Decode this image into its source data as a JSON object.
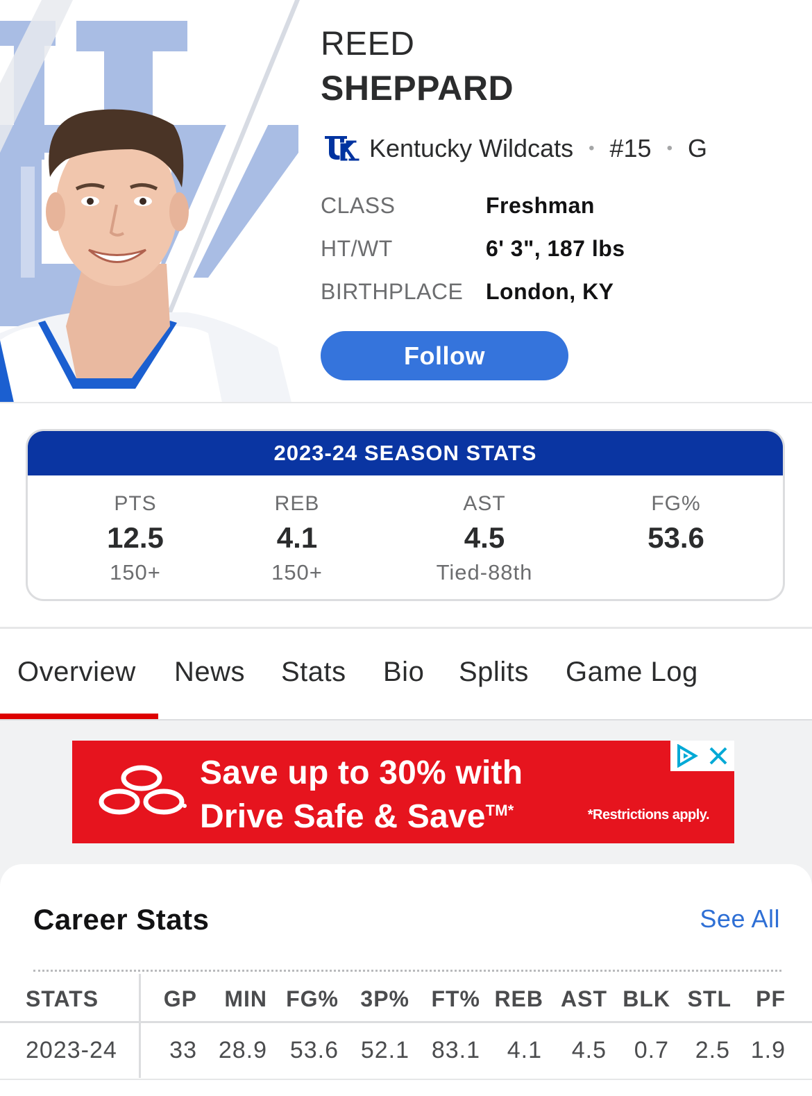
{
  "player": {
    "first_name": "REED",
    "last_name": "SHEPPARD",
    "team": "Kentucky Wildcats",
    "number": "#15",
    "position": "G",
    "bio": [
      {
        "label": "CLASS",
        "value": "Freshman"
      },
      {
        "label": "HT/WT",
        "value": "6' 3\", 187 lbs"
      },
      {
        "label": "BIRTHPLACE",
        "value": "London, KY"
      }
    ],
    "follow_label": "Follow"
  },
  "season": {
    "title": "2023-24 SEASON STATS",
    "stats": [
      {
        "label": "PTS",
        "value": "12.5",
        "rank": "150+"
      },
      {
        "label": "REB",
        "value": "4.1",
        "rank": "150+"
      },
      {
        "label": "AST",
        "value": "4.5",
        "rank": "Tied-88th"
      },
      {
        "label": "FG%",
        "value": "53.6",
        "rank": ""
      }
    ]
  },
  "tabs": [
    "Overview",
    "News",
    "Stats",
    "Bio",
    "Splits",
    "Game Log"
  ],
  "active_tab": "Overview",
  "ad": {
    "line1": "Save up to 30% with",
    "line2": "Drive Safe & Save",
    "mark": "TM*",
    "fine_print": "*Restrictions apply."
  },
  "career": {
    "title": "Career Stats",
    "see_all": "See All",
    "headers": [
      "STATS",
      "GP",
      "MIN",
      "FG%",
      "3P%",
      "FT%",
      "REB",
      "AST",
      "BLK",
      "STL",
      "PF"
    ],
    "rows": [
      [
        "2023-24",
        "33",
        "28.9",
        "53.6",
        "52.1",
        "83.1",
        "4.1",
        "4.5",
        "0.7",
        "2.5",
        "1.9"
      ]
    ]
  },
  "colors": {
    "accent_blue": "#3574dc",
    "season_header": "#0a35a2",
    "tab_indicator": "#dd0000",
    "ad_red": "#e6141e",
    "link_blue": "#2e6fd5"
  },
  "icons": [
    "kentucky-logo-icon",
    "ad-choices-icon",
    "close-icon",
    "state-farm-logo"
  ]
}
